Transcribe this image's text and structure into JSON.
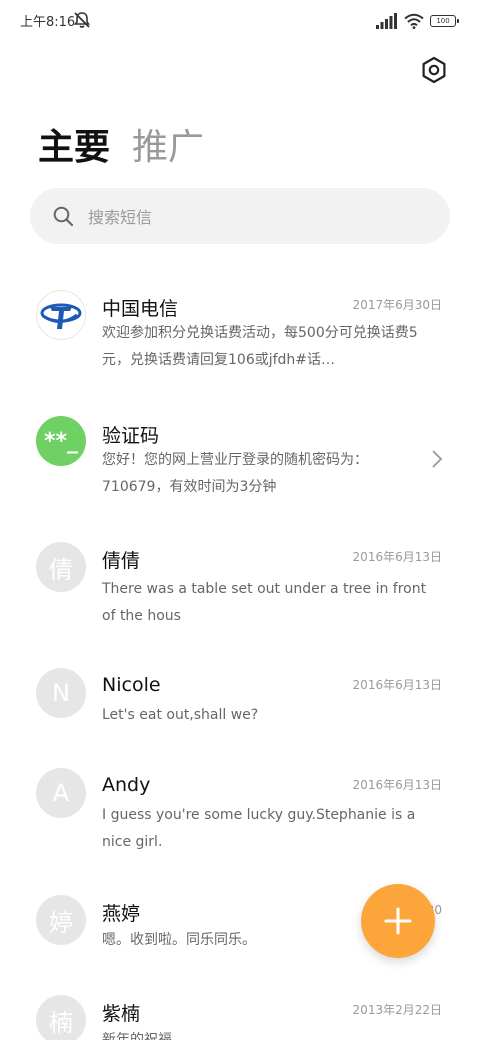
{
  "status": {
    "time": "上午8:16",
    "battery": "100"
  },
  "tabs": [
    {
      "label": "主要"
    },
    {
      "label": "推广"
    }
  ],
  "search": {
    "placeholder": "搜索短信"
  },
  "conversations": [
    {
      "name": "中国电信",
      "date": "2017年6月30日",
      "preview": "欢迎参加积分兑换话费活动，每500分可兑换话费5元，兑换话费请回复106或jfdh#话…",
      "avatar": "telecom-logo"
    },
    {
      "name": "验证码",
      "date": "",
      "preview": "您好！您的网上营业厅登录的随机密码为：710679，有效时间为3分钟",
      "avatar_text": "**_"
    },
    {
      "name": "倩倩",
      "date": "2016年6月13日",
      "preview": "There was a table set out under a tree in front of the hous",
      "avatar_text": "倩"
    },
    {
      "name": "Nicole",
      "date": "2016年6月13日",
      "preview": "Let's eat out,shall we?",
      "avatar_text": "N"
    },
    {
      "name": "Andy",
      "date": "2016年6月13日",
      "preview": "I guess you're some lucky guy.Stephanie is a nice girl.",
      "avatar_text": "A"
    },
    {
      "name": "燕婷",
      "date": "20",
      "preview": "嗯。收到啦。同乐同乐。",
      "avatar_text": "婷"
    },
    {
      "name": "紫楠",
      "date": "2013年2月22日",
      "preview": "新年的祝福",
      "avatar_text": "楠"
    }
  ],
  "colors": {
    "fab": "#fba53a",
    "verification_avatar": "#6fd063",
    "telecom_blue": "#1d5ab4"
  }
}
